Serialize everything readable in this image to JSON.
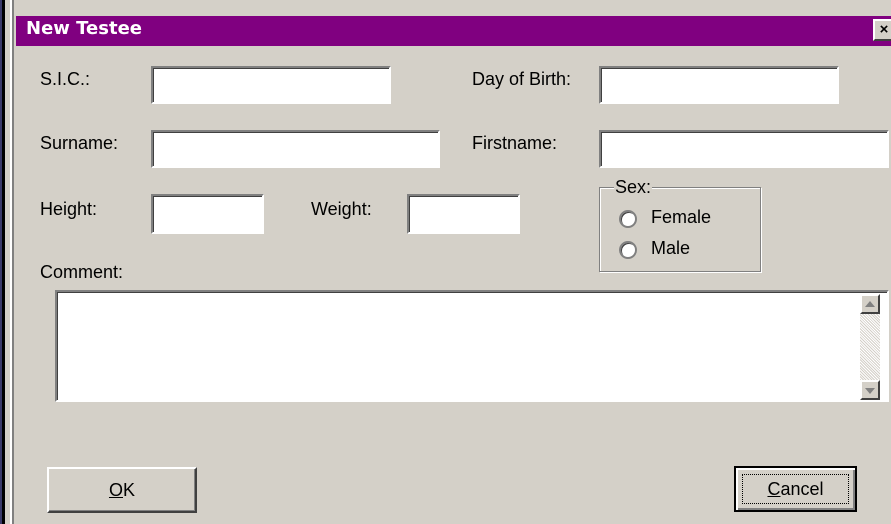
{
  "window": {
    "title": "New Testee",
    "close_glyph": "×"
  },
  "fields": {
    "sic": {
      "label": "S.I.C.:",
      "value": ""
    },
    "day_of_birth": {
      "label": "Day of Birth:",
      "value": ""
    },
    "surname": {
      "label": "Surname:",
      "value": ""
    },
    "firstname": {
      "label": "Firstname:",
      "value": ""
    },
    "height": {
      "label": "Height:",
      "value": ""
    },
    "weight": {
      "label": "Weight:",
      "value": ""
    },
    "comment": {
      "label": "Comment:",
      "value": ""
    }
  },
  "sex": {
    "label": "Sex:",
    "options": [
      "Female",
      "Male"
    ],
    "selected": null
  },
  "buttons": {
    "ok_mnemonic": "O",
    "ok_rest": "K",
    "cancel_mnemonic": "C",
    "cancel_rest": "ancel"
  },
  "colors": {
    "titlebar": "#800080",
    "dialog_bg": "#d4d0c8"
  },
  "icons": {
    "close": "close-icon",
    "scroll_up": "scroll-up-arrow-icon",
    "scroll_down": "scroll-down-arrow-icon"
  }
}
